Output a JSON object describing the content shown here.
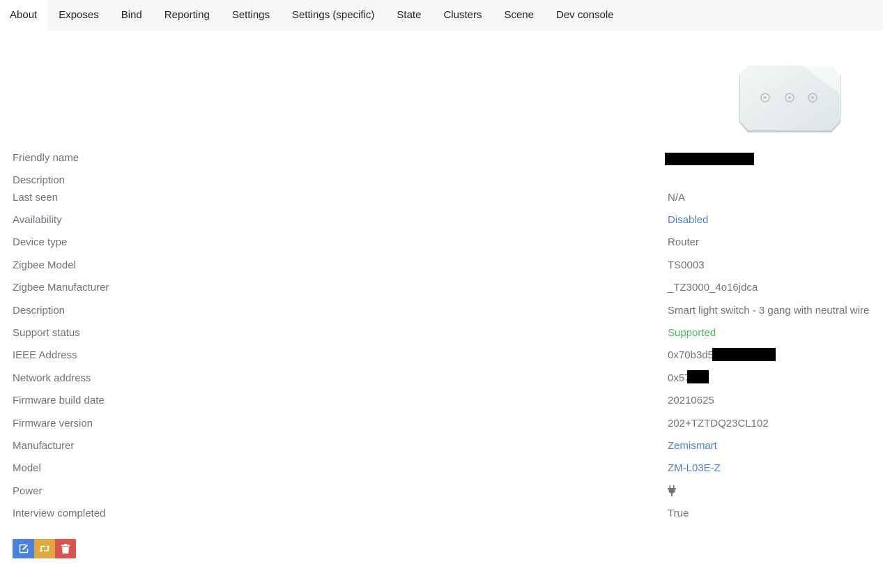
{
  "tabs": [
    {
      "label": "About",
      "active": true
    },
    {
      "label": "Exposes"
    },
    {
      "label": "Bind"
    },
    {
      "label": "Reporting"
    },
    {
      "label": "Settings"
    },
    {
      "label": "Settings (specific)"
    },
    {
      "label": "State"
    },
    {
      "label": "Clusters"
    },
    {
      "label": "Scene"
    },
    {
      "label": "Dev console"
    }
  ],
  "properties": {
    "friendly_name": {
      "label": "Friendly name",
      "value": ""
    },
    "description_user": {
      "label": "Description",
      "value": ""
    },
    "last_seen": {
      "label": "Last seen",
      "value": "N/A"
    },
    "availability": {
      "label": "Availability",
      "value": "Disabled"
    },
    "device_type": {
      "label": "Device type",
      "value": "Router"
    },
    "zigbee_model": {
      "label": "Zigbee Model",
      "value": "TS0003"
    },
    "zigbee_manufacturer": {
      "label": "Zigbee Manufacturer",
      "value": "_TZ3000_4o16jdca"
    },
    "description": {
      "label": "Description",
      "value": "Smart light switch - 3 gang with neutral wire"
    },
    "support_status": {
      "label": "Support status",
      "value": "Supported"
    },
    "ieee_address": {
      "label": "IEEE Address",
      "value": "0x70b3d5"
    },
    "network_address": {
      "label": "Network address",
      "value": "0x57"
    },
    "firmware_build_date": {
      "label": "Firmware build date",
      "value": "20210625"
    },
    "firmware_version": {
      "label": "Firmware version",
      "value": "202+TZTDQ23CL102"
    },
    "manufacturer": {
      "label": "Manufacturer",
      "value": "Zemismart"
    },
    "model": {
      "label": "Model",
      "value": "ZM-L03E-Z"
    },
    "power": {
      "label": "Power",
      "icon": "plug-icon"
    },
    "interview_completed": {
      "label": "Interview completed",
      "value": "True"
    }
  },
  "actions": {
    "rename": {
      "icon": "edit-icon",
      "color": "#4a80e0"
    },
    "reconfigure": {
      "icon": "retweet-icon",
      "color": "#e2a73e"
    },
    "remove": {
      "icon": "trash-icon",
      "color": "#d9534f"
    }
  },
  "colors": {
    "link": "#4f7fd3",
    "supported": "#4cb85c",
    "muted": "#6c757d",
    "tabbar_bg": "#f7f7f9"
  }
}
